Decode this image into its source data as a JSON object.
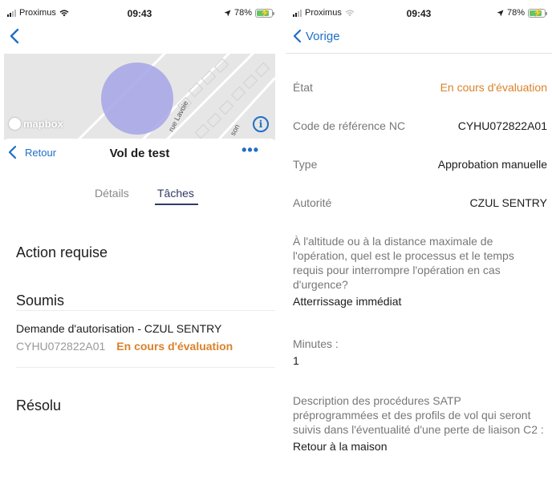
{
  "status_bar": {
    "carrier": "Proximus",
    "time": "09:43",
    "battery": "78%"
  },
  "left": {
    "map_logo": "mapbox",
    "map_streets": [
      "rue Lavoie",
      "son"
    ],
    "nav": {
      "back_label": "Retour",
      "title": "Vol de test",
      "more": "•••"
    },
    "tabs": [
      {
        "label": "Détails",
        "selected": false
      },
      {
        "label": "Tâches",
        "selected": true
      }
    ],
    "sections": {
      "action": "Action requise",
      "soumis": "Soumis",
      "resolu": "Résolu"
    },
    "request": {
      "title": "Demande d'autorisation  -  CZUL SENTRY",
      "code": "CYHU072822A01",
      "status": "En cours d'évaluation"
    }
  },
  "right": {
    "nav": {
      "back_label": "Vorige"
    },
    "rows": [
      {
        "label": "État",
        "value": "En cours d'évaluation",
        "highlight": true
      },
      {
        "label": "Code de référence NC",
        "value": "CYHU072822A01",
        "highlight": false
      },
      {
        "label": "Type",
        "value": "Approbation manuelle",
        "highlight": false
      },
      {
        "label": "Autorité",
        "value": "CZUL SENTRY",
        "highlight": false
      }
    ],
    "questions": [
      {
        "q": "À l'altitude ou à la distance maximale de l'opération, quel est le processus et le temps requis pour interrompre l'opération en cas d'urgence?",
        "a": "Atterrissage immédiat"
      },
      {
        "q": "Minutes :",
        "a": "1"
      },
      {
        "q": "Description des procédures SATP préprogrammées et des profils de vol qui seront suivis dans l'éventualité d'une perte de liaison C2 :",
        "a": "Retour à la maison"
      }
    ]
  },
  "colors": {
    "accent": "#1f6fc7",
    "status_orange": "#d9822b",
    "tab_active": "#2f3a66",
    "map_circle": "#a5a3e6"
  }
}
